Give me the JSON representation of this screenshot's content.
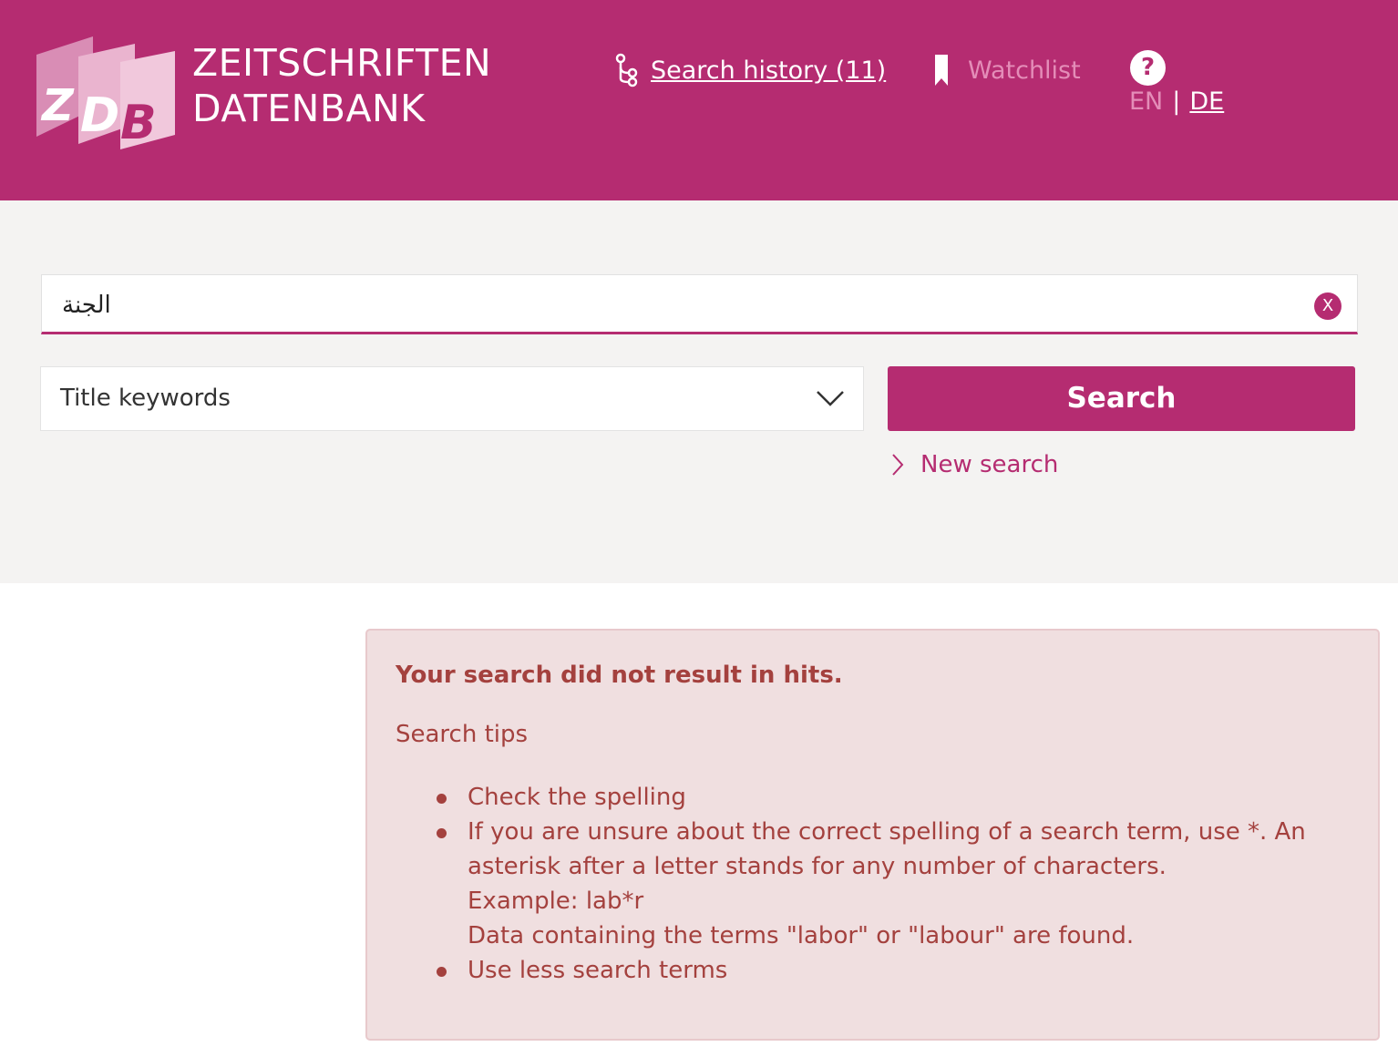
{
  "header": {
    "brand_line1": "ZEITSCHRIFTEN",
    "brand_line2": "DATENBANK",
    "search_history_label": "Search history (11)",
    "watchlist_label": "Watchlist",
    "lang_en": "EN",
    "lang_sep": "|",
    "lang_de": "DE",
    "help_glyph": "?"
  },
  "search": {
    "query_value": "الجنة",
    "clear_label": "X",
    "field_select_value": "Title keywords",
    "search_button_label": "Search",
    "new_search_label": "New search"
  },
  "results": {
    "alert_title": "Your search did not result in hits.",
    "tips_heading": "Search tips",
    "tips": [
      {
        "lines": [
          "Check the spelling"
        ]
      },
      {
        "lines": [
          "If you are unsure about the correct spelling of a search term, use *. An asterisk after a letter stands for any number of characters.",
          "Example: lab*r",
          "Data containing the terms \"labor\" or \"labour\" are found."
        ]
      },
      {
        "lines": [
          "Use less search terms"
        ]
      }
    ]
  },
  "colors": {
    "brand": "#b52c71",
    "brand_light": "#e48db8",
    "alert_bg": "#f0dfe0",
    "alert_text": "#a4413e",
    "search_area_bg": "#f4f3f2"
  },
  "icons": {
    "logo": "zdb-logo",
    "history": "history-branch-icon",
    "watchlist": "bookmark-icon",
    "help": "help-icon",
    "clear": "clear-icon",
    "select": "chevron-down-icon",
    "new_search": "chevron-right-icon"
  }
}
